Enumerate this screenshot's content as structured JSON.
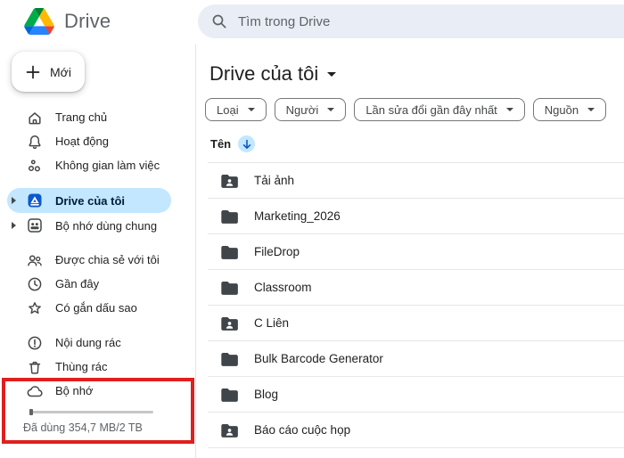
{
  "app": {
    "wordmark": "Drive"
  },
  "header": {
    "search": {
      "placeholder": "Tìm trong Drive"
    }
  },
  "sidebar": {
    "new_button": "Mới",
    "groups": [
      {
        "items": [
          {
            "label": "Trang chủ"
          },
          {
            "label": "Hoạt động"
          },
          {
            "label": "Không gian làm việc"
          }
        ]
      },
      {
        "items": [
          {
            "label": "Drive của tôi",
            "selected": true
          },
          {
            "label": "Bộ nhớ dùng chung"
          }
        ]
      },
      {
        "items": [
          {
            "label": "Được chia sẻ với tôi"
          },
          {
            "label": "Gần đây"
          },
          {
            "label": "Có gắn dấu sao"
          }
        ]
      },
      {
        "items": [
          {
            "label": "Nội dung rác"
          },
          {
            "label": "Thùng rác"
          },
          {
            "label": "Bộ nhớ"
          }
        ]
      }
    ],
    "storage": {
      "usage_text": "Đã dùng 354,7 MB/2 TB"
    }
  },
  "main": {
    "title": "Drive của tôi",
    "filters": {
      "type": "Loại",
      "people": "Người",
      "modified": "Lần sửa đổi gần đây nhất",
      "source": "Nguồn"
    },
    "list": {
      "name_header": "Tên",
      "sort": "descending",
      "rows": [
        {
          "name": "Tải ảnh",
          "shared": true
        },
        {
          "name": "Marketing_2026",
          "shared": false
        },
        {
          "name": "FileDrop",
          "shared": false
        },
        {
          "name": "Classroom",
          "shared": false
        },
        {
          "name": "C Liên",
          "shared": true
        },
        {
          "name": "Bulk Barcode Generator",
          "shared": false
        },
        {
          "name": "Blog",
          "shared": false
        },
        {
          "name": "Báo cáo cuộc họp",
          "shared": true
        }
      ]
    }
  },
  "annotation": {
    "highlight_color": "#e01f1f",
    "highlighted_item": "Bộ nhớ"
  },
  "colors": {
    "accent_blue": "#0b57d0",
    "selected_pill": "#c2e7ff",
    "search_bg": "#e9eef6",
    "icon_gray": "#444746",
    "folder_gray": "#40454a"
  }
}
